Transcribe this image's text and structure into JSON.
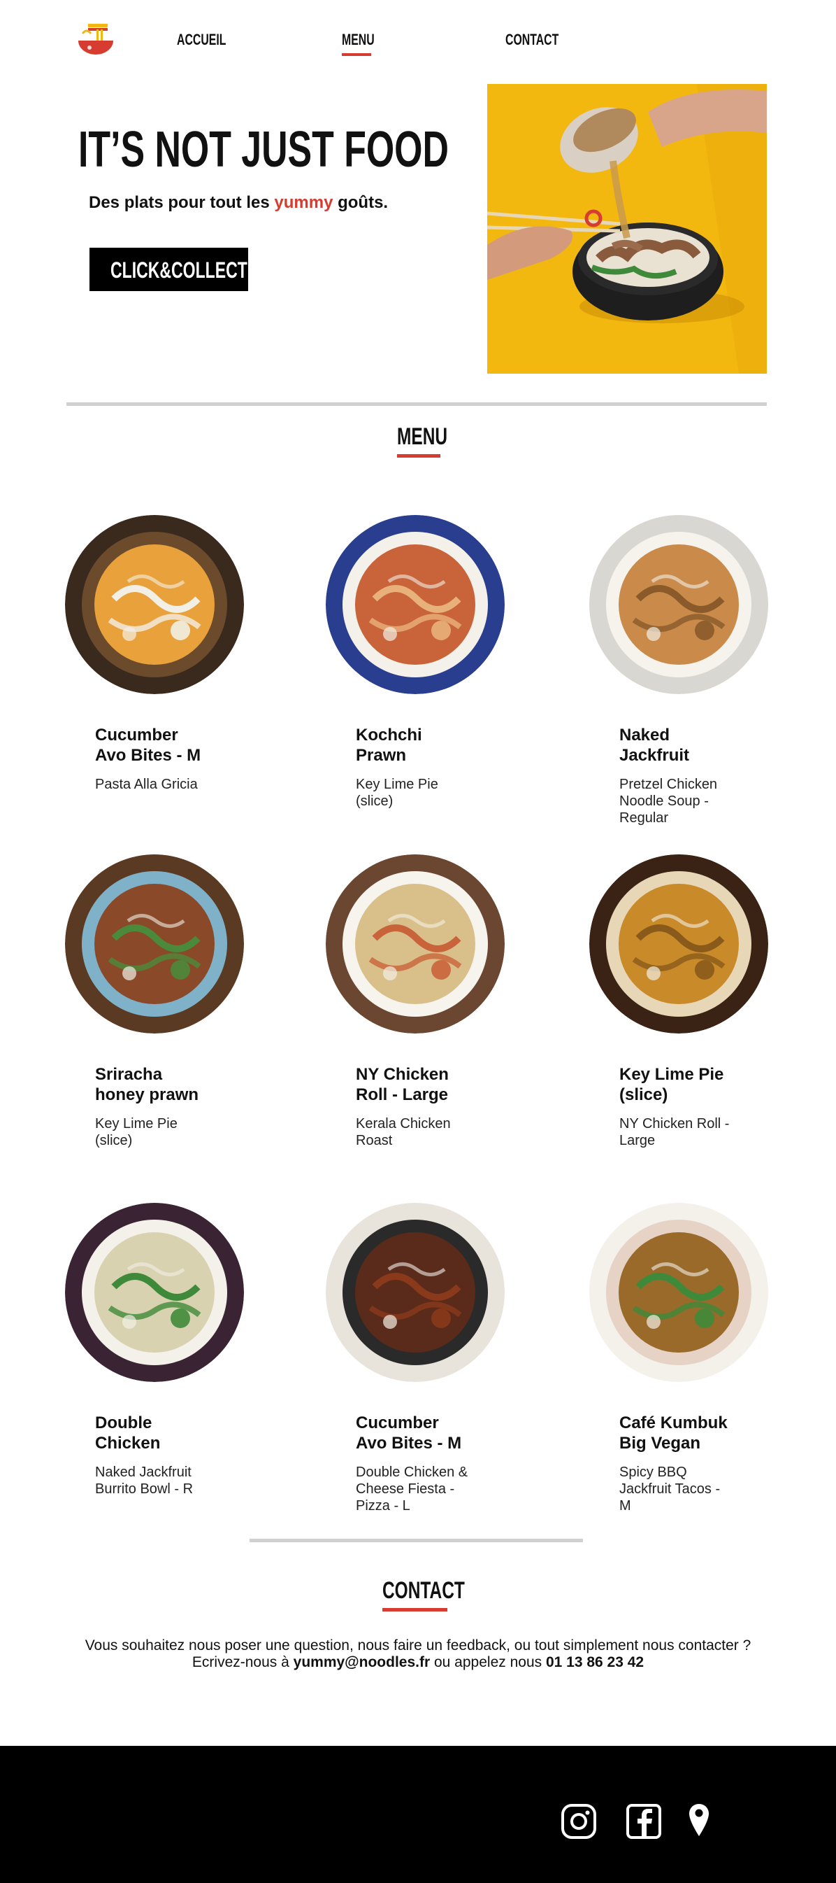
{
  "nav": {
    "logo_icon": "ramen-bowl-logo",
    "links": [
      {
        "label": "ACCUEIL"
      },
      {
        "label": "MENU"
      },
      {
        "label": "CONTACT"
      }
    ]
  },
  "hero": {
    "title": "IT’S NOT JUST FOOD",
    "subtitle_before": "Des plats pour tout les ",
    "subtitle_accent": "yummy",
    "subtitle_after": " goûts.",
    "cta_label": "CLICK&COLLECT",
    "image": "noodle-bowl-photo"
  },
  "menu": {
    "title": "MENU",
    "dishes": [
      {
        "name": "Cucumber\nAvo Bites - M",
        "desc": "Pasta Alla Gricia"
      },
      {
        "name": "Kochchi\nPrawn",
        "desc": "Key Lime Pie\n(slice)"
      },
      {
        "name": "Naked\nJackfruit",
        "desc": "Pretzel Chicken\nNoodle Soup -\nRegular"
      },
      {
        "name": "Sriracha\nhoney prawn",
        "desc": "Key Lime Pie\n(slice)"
      },
      {
        "name": "NY Chicken\nRoll - Large",
        "desc": "Kerala Chicken\nRoast"
      },
      {
        "name": "Key Lime Pie\n(slice)",
        "desc": "NY Chicken Roll -\nLarge"
      },
      {
        "name": "Double\nChicken",
        "desc": "Naked Jackfruit\nBurrito Bowl - R"
      },
      {
        "name": "Cucumber\nAvo Bites - M",
        "desc": "Double Chicken &\nCheese Fiesta -\nPizza - L"
      },
      {
        "name": "Café Kumbuk\nBig Vegan",
        "desc": "Spicy BBQ\nJackfruit Tacos -\nM"
      }
    ]
  },
  "contact": {
    "title": "CONTACT",
    "line1": "Vous souhaitez nous poser une question, nous faire un feedback, ou tout simplement nous contacter ?",
    "line2_before": "Ecrivez-nous à ",
    "email": "yummy@noodles.fr",
    "line2_middle": " ou appelez nous ",
    "phone": "01 13 86 23 42"
  },
  "footer": {
    "icons": [
      "instagram-icon",
      "facebook-icon",
      "location-pin-icon"
    ]
  },
  "colors": {
    "accent": "#d63c2f",
    "hero_bg": "#f3b80f",
    "footer_bg": "#000000"
  }
}
